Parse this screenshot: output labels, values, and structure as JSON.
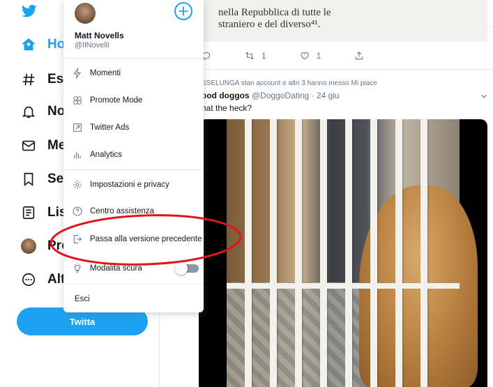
{
  "app": {
    "brand_color": "#1da1f2",
    "logo_icon": "twitter-bird-icon"
  },
  "left_nav": {
    "items": [
      {
        "label": "Home",
        "visible": "Hom",
        "icon": "home-icon",
        "active": true
      },
      {
        "label": "Esplora",
        "visible": "Esp",
        "icon": "hashtag-icon"
      },
      {
        "label": "Notifiche",
        "visible": "Not",
        "icon": "bell-icon"
      },
      {
        "label": "Messaggi",
        "visible": "Me",
        "icon": "envelope-icon"
      },
      {
        "label": "Segnalibri",
        "visible": "Seg",
        "icon": "bookmark-icon"
      },
      {
        "label": "Liste",
        "visible": "List",
        "icon": "list-icon"
      },
      {
        "label": "Profilo",
        "visible": "Pro",
        "icon": "avatar"
      },
      {
        "label": "Altro",
        "visible": "Alt",
        "icon": "more-circle-icon"
      }
    ],
    "tweet_button": "Twitta"
  },
  "menu": {
    "user": {
      "name": "Matt Novells",
      "handle": "@IlNovelli"
    },
    "items_group1": [
      {
        "label": "Momenti",
        "icon": "lightning-icon"
      },
      {
        "label": "Promote Mode",
        "icon": "promote-icon"
      },
      {
        "label": "Twitter Ads",
        "icon": "external-box-icon"
      },
      {
        "label": "Analytics",
        "icon": "bar-chart-icon"
      }
    ],
    "items_group2": [
      {
        "label": "Impostazioni e privacy",
        "icon": "gear-icon"
      },
      {
        "label": "Centro assistenza",
        "icon": "help-circle-icon"
      },
      {
        "label": "Passa alla versione precedente",
        "icon": "exit-arrow-icon"
      },
      {
        "label": "Modalità scura",
        "icon": "bulb-icon",
        "toggle": false
      }
    ],
    "logout": "Esci"
  },
  "feed": {
    "book_snippet": [
      "nella Repubblica di tutte le",
      "straniero e del diverso⁴¹."
    ],
    "actions": {
      "retweets": "1",
      "likes": "1"
    },
    "social_context": "SSELUNGA stan account e altri 3 hanno messo Mi piace",
    "tweet": {
      "name": "ood doggos",
      "handle": "@DoggoDating",
      "time": "· 24 giu",
      "text": "hat the heck?"
    }
  }
}
